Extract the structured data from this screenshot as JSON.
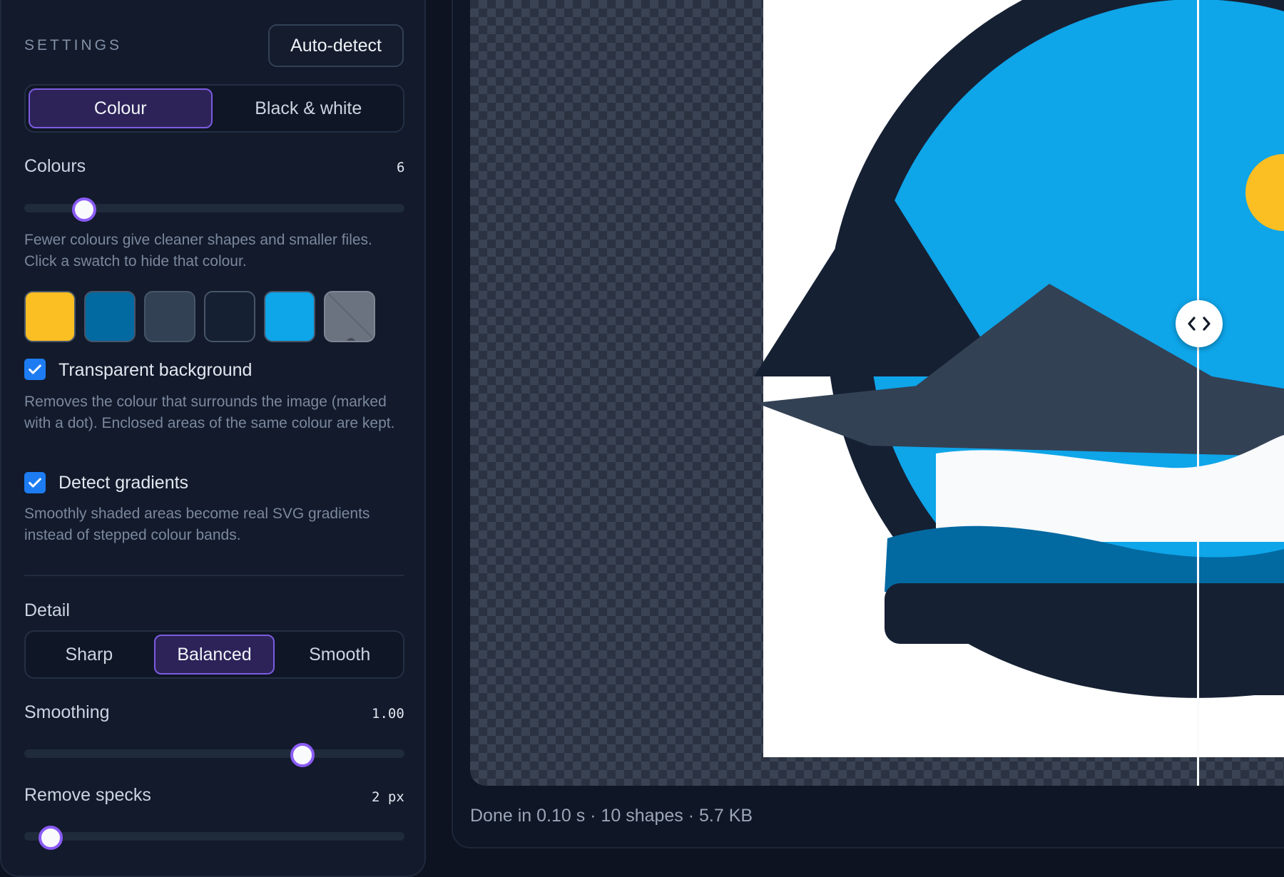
{
  "settings": {
    "title": "SETTINGS",
    "auto_detect_label": "Auto-detect",
    "mode_tabs": [
      {
        "label": "Colour",
        "active": true
      },
      {
        "label": "Black & white",
        "active": false
      }
    ],
    "colours": {
      "label": "Colours",
      "value": "6",
      "slider_fraction": 0.155,
      "help": "Fewer colours give cleaner shapes and smaller files. Click a swatch to hide that colour.",
      "swatches": [
        {
          "color": "#fbbf24",
          "hidden": false
        },
        {
          "color": "#0369a1",
          "hidden": false
        },
        {
          "color": "#334155",
          "hidden": false
        },
        {
          "color": "#162033",
          "hidden": false
        },
        {
          "color": "#0ea5e9",
          "hidden": false
        },
        {
          "color": "#6b7280",
          "hidden": true,
          "background_dot": true
        }
      ]
    },
    "transparent_background": {
      "label": "Transparent background",
      "checked": true,
      "help": "Removes the colour that surrounds the image (marked with a dot). Enclosed areas of the same colour are kept."
    },
    "detect_gradients": {
      "label": "Detect gradients",
      "checked": true,
      "help": "Smoothly shaded areas become real SVG gradients instead of stepped colour bands."
    },
    "detail": {
      "label": "Detail",
      "options": [
        {
          "label": "Sharp",
          "active": false
        },
        {
          "label": "Balanced",
          "active": true
        },
        {
          "label": "Smooth",
          "active": false
        }
      ]
    },
    "smoothing": {
      "label": "Smoothing",
      "value": "1.00",
      "slider_fraction": 0.73
    },
    "remove_specks": {
      "label": "Remove specks",
      "value": "2 px",
      "slider_fraction": 0.067
    }
  },
  "preview": {
    "status": "Done in 0.10 s · 10 shapes · 5.7 KB",
    "split_handle_icon": "split-arrows-icon"
  },
  "colors": {
    "accent": "#8b5cf6",
    "checkbox": "#1d7cf2"
  }
}
